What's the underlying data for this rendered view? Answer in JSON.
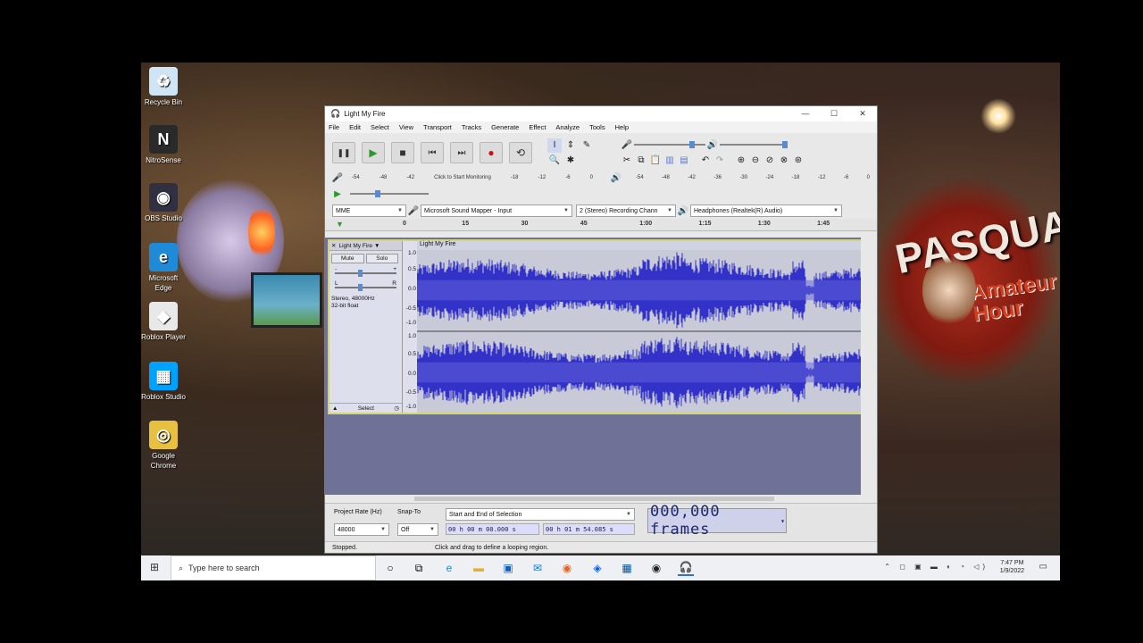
{
  "desktop": {
    "icons": [
      {
        "label": "Recycle Bin",
        "glyph": "♻",
        "color": "#cfe4f4"
      },
      {
        "label": "NitroSense",
        "glyph": "N",
        "color": "#2a2a2a"
      },
      {
        "label": "OBS Studio",
        "glyph": "◉",
        "color": "#303040"
      },
      {
        "label": "Microsoft Edge",
        "glyph": "e",
        "color": "#1f8ad8"
      },
      {
        "label": "Roblox Player",
        "glyph": "◆",
        "color": "#e8e8e8"
      },
      {
        "label": "Roblox Studio",
        "glyph": "▦",
        "color": "#00a2ff"
      },
      {
        "label": "Google Chrome",
        "glyph": "◎",
        "color": "#e8c040"
      }
    ],
    "background_sign": "PASQUAL",
    "background_sign2": "Amateur Hour"
  },
  "window": {
    "title": "Light My Fire",
    "controls": [
      "—",
      "☐",
      "✕"
    ]
  },
  "menu": [
    "File",
    "Edit",
    "Select",
    "View",
    "Transport",
    "Tracks",
    "Generate",
    "Effect",
    "Analyze",
    "Tools",
    "Help"
  ],
  "transport": {
    "pause": "❚❚",
    "play": "▶",
    "stop": "■",
    "skip_start": "⏮",
    "skip_end": "⏭",
    "record": "●",
    "loop": "⟲"
  },
  "meters": {
    "record_scale": [
      "-54",
      "-48",
      "-42",
      "Click to Start Monitoring",
      "-18",
      "-12",
      "-6",
      "0"
    ],
    "play_scale": [
      "-54",
      "-48",
      "-42",
      "-36",
      "-30",
      "-24",
      "-18",
      "-12",
      "-6",
      "0"
    ],
    "lr": "L\nR"
  },
  "devices": {
    "host": "MME",
    "input": "Microsoft Sound Mapper - Input",
    "channels": "2 (Stereo) Recording Chann",
    "output": "Headphones (Realtek(R) Audio)"
  },
  "timeline": {
    "ticks": [
      "0",
      "15",
      "30",
      "45",
      "1:00",
      "1:15",
      "1:30",
      "1:45"
    ]
  },
  "track": {
    "name": "Light My Fire",
    "clip_name": "Light My Fire",
    "mute": "Mute",
    "solo": "Solo",
    "gain_minus": "-",
    "gain_plus": "+",
    "pan_l": "L",
    "pan_r": "R",
    "info": "Stereo, 48000Hz\n32-bit float",
    "select": "Select",
    "scale": [
      "1.0",
      "0.5",
      "0.0",
      "-0.5",
      "-1.0"
    ],
    "scale2": [
      "1.0",
      "0.5",
      "0.0",
      "-0.5",
      "-1.0"
    ],
    "wave_color": "#3232c8"
  },
  "bottom": {
    "project_rate_label": "Project Rate (Hz)",
    "project_rate": "48000",
    "snap_label": "Snap-To",
    "snap": "Off",
    "selection_mode": "Start and End of Selection",
    "sel_start": "00 h 00 m 00.000 s",
    "sel_end": "00 h 01 m 54.085 s",
    "big_time": "000,000 frames"
  },
  "status": {
    "state": "Stopped.",
    "hint": "Click and drag to define a looping region."
  },
  "taskbar": {
    "search_placeholder": "Type here to search",
    "time": "7:47 PM",
    "date": "1/9/2022"
  }
}
